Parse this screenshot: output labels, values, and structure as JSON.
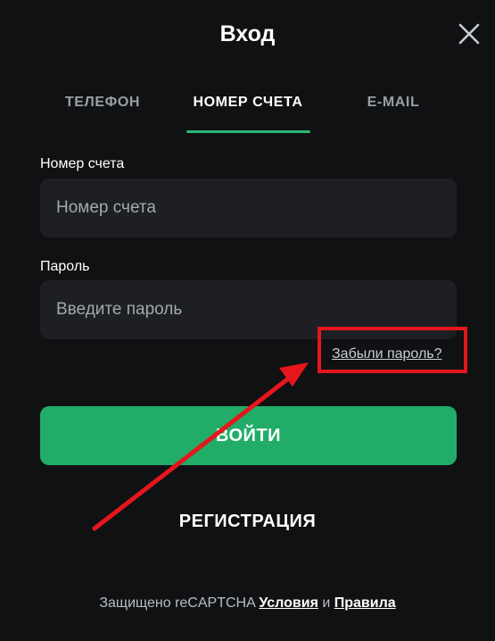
{
  "dialog": {
    "title": "Вход"
  },
  "tabs": [
    {
      "label": "ТЕЛЕФОН",
      "active": false
    },
    {
      "label": "НОМЕР СЧЕТА",
      "active": true
    },
    {
      "label": "E-MAIL",
      "active": false
    }
  ],
  "account_field": {
    "label": "Номер счета",
    "placeholder": "Номер счета",
    "value": ""
  },
  "password_field": {
    "label": "Пароль",
    "placeholder": "Введите пароль",
    "value": ""
  },
  "forgot_password": {
    "label": "Забыли пароль?"
  },
  "login_button": {
    "label": "ВОЙТИ"
  },
  "register_button": {
    "label": "РЕГИСТРАЦИЯ"
  },
  "footer": {
    "prefix": "Защищено reCAPTCHA",
    "terms_label": "Условия",
    "conjunction": "и",
    "rules_label": "Правила"
  },
  "annotation": {
    "highlight_color": "#e5161c",
    "arrow_color": "#e5161c"
  },
  "colors": {
    "accent": "#21ad68",
    "background": "#101113",
    "input_background": "#1d1f23"
  },
  "icons": {
    "close": "close-icon"
  }
}
